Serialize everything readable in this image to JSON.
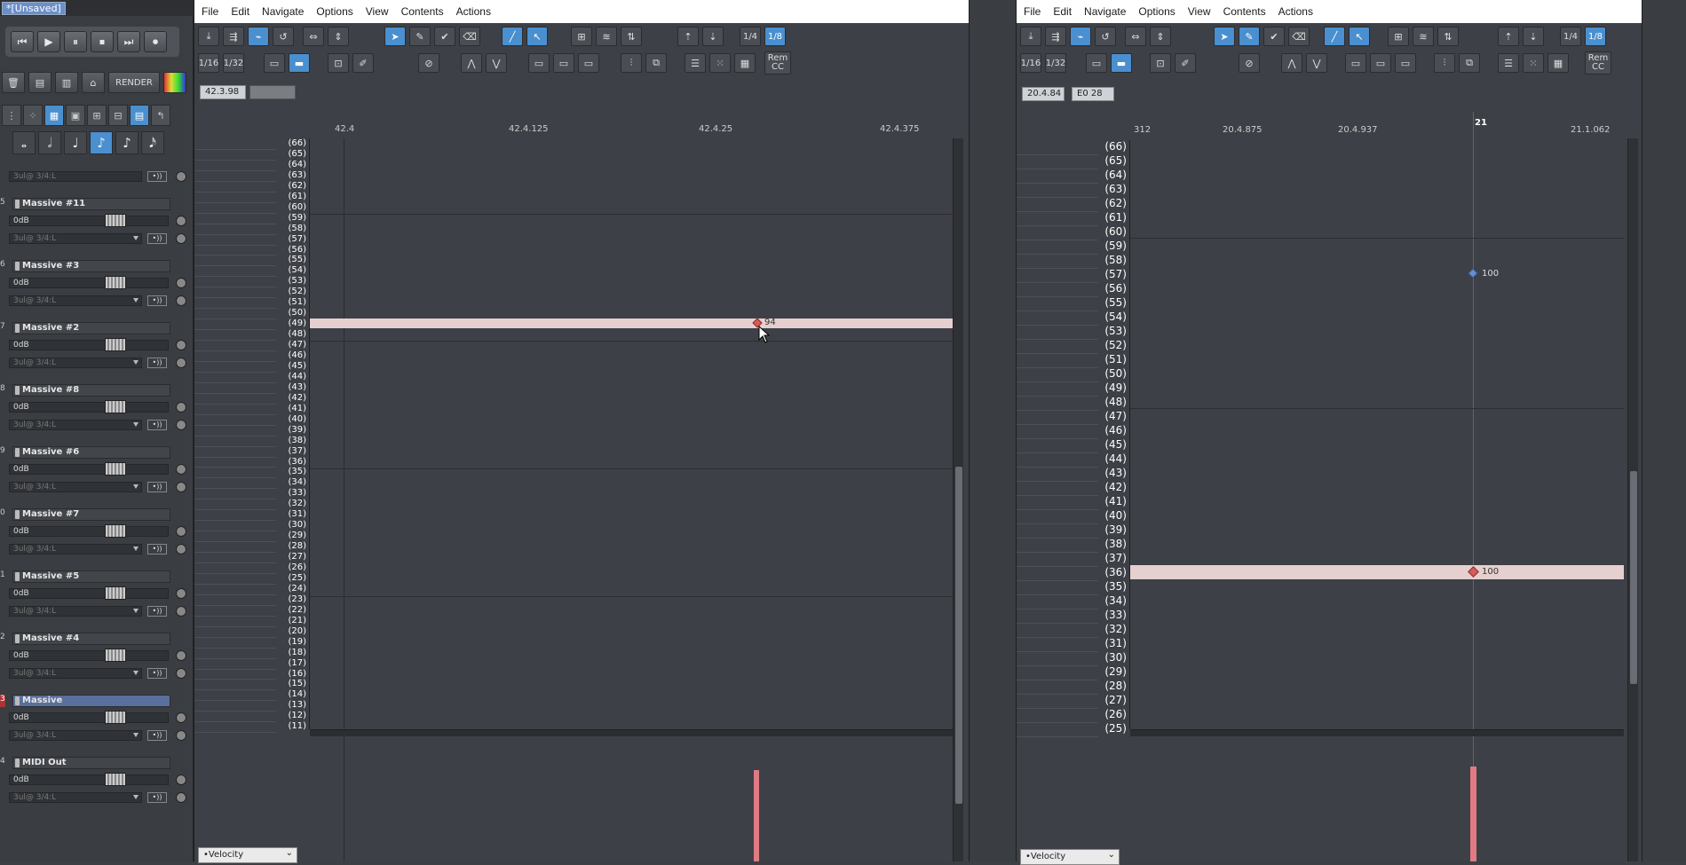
{
  "app_title": "*[Unsaved]",
  "transport": [
    "⏮",
    "▶",
    "⏸",
    "⏹",
    "⏭",
    "⏺"
  ],
  "render_label": "RENDER",
  "tracks": [
    {
      "num": "",
      "name": "",
      "vol": "",
      "io": "3ul@ 3/4:L"
    },
    {
      "num": "5",
      "name": "Massive #11",
      "vol": "0dB",
      "io": "3ul@ 3/4:L",
      "btn": "•))"
    },
    {
      "num": "6",
      "name": "Massive #3",
      "vol": "0dB",
      "io": "3ul@ 3/4:L",
      "btn": "•))"
    },
    {
      "num": "7",
      "name": "Massive #2",
      "vol": "0dB",
      "io": "3ul@ 3/4:L",
      "btn": "•))"
    },
    {
      "num": "8",
      "name": "Massive #8",
      "vol": "0dB",
      "io": "3ul@ 3/4:L",
      "btn": "•))"
    },
    {
      "num": "9",
      "name": "Massive #6",
      "vol": "0dB",
      "io": "3ul@ 3/4:L",
      "btn": "•))"
    },
    {
      "num": "0",
      "name": "Massive #7",
      "vol": "0dB",
      "io": "3ul@ 3/4:L",
      "btn": "•))"
    },
    {
      "num": "1",
      "name": "Massive #5",
      "vol": "0dB",
      "io": "3ul@ 3/4:L",
      "btn": "•))"
    },
    {
      "num": "2",
      "name": "Massive #4",
      "vol": "0dB",
      "io": "3ul@ 3/4:L",
      "btn": "•))"
    },
    {
      "num": "3",
      "name": "Massive",
      "vol": "0dB",
      "io": "3ul@ 3/4:L",
      "btn": "•))",
      "selected": true
    },
    {
      "num": "4",
      "name": "MIDI Out",
      "vol": "0dB",
      "io": "3ul@ 3/4:L",
      "btn": "•))"
    }
  ],
  "editor_left": {
    "menu": [
      "File",
      "Edit",
      "Navigate",
      "Options",
      "View",
      "Contents",
      "Actions"
    ],
    "grid_labels": {
      "g1": "1/4",
      "g2": "1/8",
      "g3": "1/16",
      "g4": "1/32",
      "rem": "Rem",
      "cc": "CC"
    },
    "position": "42.3.98",
    "position2": "",
    "ruler": [
      "42.4",
      "42.4.125",
      "42.4.25",
      "42.4.375"
    ],
    "keys": [
      "(66)",
      "(65)",
      "(64)",
      "(63)",
      "(62)",
      "(61)",
      "(60)",
      "(59)",
      "(58)",
      "(57)",
      "(56)",
      "(55)",
      "(54)",
      "(53)",
      "(52)",
      "(51)",
      "(50)",
      "(49)",
      "(48)",
      "(47)",
      "(46)",
      "(45)",
      "(44)",
      "(43)",
      "(42)",
      "(41)",
      "(40)",
      "(39)",
      "(38)",
      "(37)",
      "(36)",
      "(35)",
      "(34)",
      "(33)",
      "(32)",
      "(31)",
      "(30)",
      "(29)",
      "(28)",
      "(27)",
      "(26)",
      "(25)",
      "(24)",
      "(23)",
      "(22)",
      "(21)",
      "(20)",
      "(19)",
      "(18)",
      "(17)",
      "(16)",
      "(15)",
      "(14)",
      "(13)",
      "(12)",
      "(11)"
    ],
    "note_value": "94",
    "lane": "•Velocity"
  },
  "editor_right": {
    "menu": [
      "File",
      "Edit",
      "Navigate",
      "Options",
      "View",
      "Contents",
      "Actions"
    ],
    "grid_labels": {
      "g1": "1/4",
      "g2": "1/8",
      "g3": "1/16",
      "g4": "1/32",
      "rem": "Rem",
      "cc": "CC"
    },
    "position": "20.4.84",
    "position2": "E0  28",
    "ruler": [
      "312",
      "20.4.875",
      "20.4.937",
      "21",
      "21.1.062"
    ],
    "keys": [
      "(66)",
      "(65)",
      "(64)",
      "(63)",
      "(62)",
      "(61)",
      "(60)",
      "(59)",
      "(58)",
      "(57)",
      "(56)",
      "(55)",
      "(54)",
      "(53)",
      "(52)",
      "(51)",
      "(50)",
      "(49)",
      "(48)",
      "(47)",
      "(46)",
      "(45)",
      "(44)",
      "(43)",
      "(42)",
      "(41)",
      "(40)",
      "(39)",
      "(38)",
      "(37)",
      "(36)",
      "(35)",
      "(34)",
      "(33)",
      "(32)",
      "(31)",
      "(30)",
      "(29)",
      "(28)",
      "(27)",
      "(26)",
      "(25)"
    ],
    "note_value_top": "100",
    "note_value": "100",
    "lane": "•Velocity"
  },
  "colors": {
    "accent": "#4a8fcf",
    "highlight_row": "#e6cfcf",
    "velocity": "#e07a84"
  }
}
